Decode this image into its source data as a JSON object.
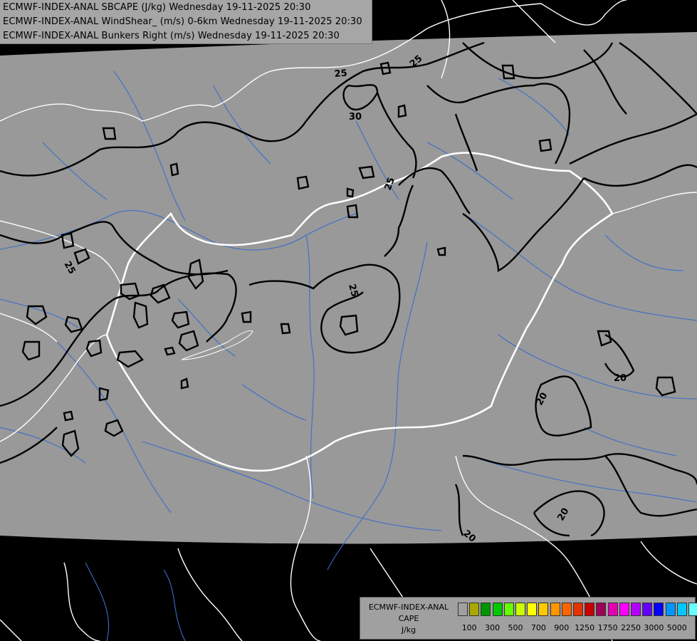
{
  "header": {
    "line1": "ECMWF-INDEX-ANAL SBCAPE (J/kg) Wednesday 19-11-2025 20:30",
    "line2": "ECMWF-INDEX-ANAL WindShear_ (m/s) 0-6km Wednesday 19-11-2025 20:30",
    "line3": "ECMWF-INDEX-ANAL Bunkers Right (m/s) Wednesday 19-11-2025 20:30"
  },
  "legend": {
    "title1": "ECMWF-INDEX-ANAL",
    "title2": "CAPE",
    "unit": "J/kg",
    "colors": [
      "#a0a0a0",
      "#a8a800",
      "#009600",
      "#00c800",
      "#64ff00",
      "#c8ff00",
      "#ffff00",
      "#ffc800",
      "#ff9600",
      "#ff6400",
      "#e63200",
      "#c80000",
      "#a0005a",
      "#e600b4",
      "#ff00ff",
      "#b400ff",
      "#6400ff",
      "#0000ff",
      "#0096ff",
      "#00c8ff",
      "#64ffff",
      "#ffffff"
    ],
    "ticks": [
      "100",
      "300",
      "500",
      "700",
      "900",
      "1250",
      "1750",
      "2250",
      "3000",
      "5000"
    ]
  },
  "contour_labels": {
    "l25a": "25",
    "l25b": "25",
    "l30": "30",
    "l25c": "25",
    "l25d": "25",
    "l25e": "25",
    "l20a": "20",
    "l20b": "20",
    "l20c": "20",
    "l20d": "20"
  },
  "colors": {
    "domain": "#999999",
    "outside": "#000000",
    "borders": "#ffffff",
    "rivers": "#3c6ec8",
    "contours": "#000000"
  }
}
